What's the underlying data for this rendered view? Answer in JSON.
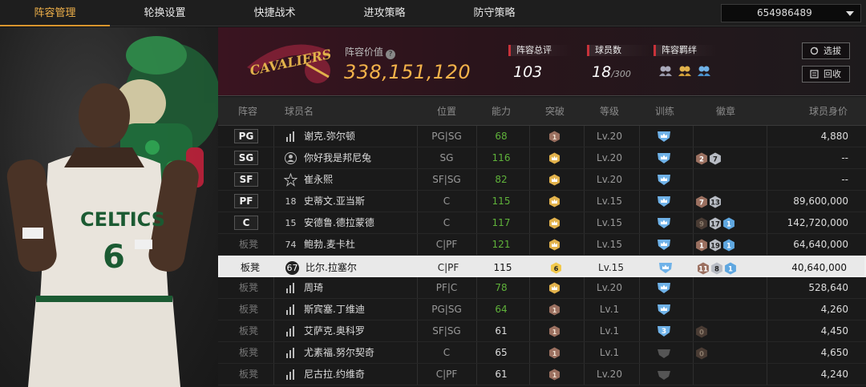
{
  "tabs": [
    "阵容管理",
    "轮换设置",
    "快捷战术",
    "进攻策略",
    "防守策略"
  ],
  "account": "654986489",
  "header": {
    "logo_text": "CAVALIERS",
    "value_label": "阵容价值",
    "value": "338,151,120",
    "stats": [
      {
        "label": "阵容总评",
        "value": "103",
        "suffix": ""
      },
      {
        "label": "球员数",
        "value": "18",
        "suffix": "/300"
      },
      {
        "label": "阵容羁绊",
        "value": "",
        "suffix": ""
      }
    ],
    "buttons": [
      "选拔",
      "回收"
    ]
  },
  "columns": [
    "阵容",
    "球员名",
    "位置",
    "能力",
    "突破",
    "等级",
    "训练",
    "徽章",
    "球员身价"
  ],
  "colors": {
    "accent": "#f0b14a",
    "green": "#5fb23a",
    "red": "#c8323a"
  },
  "rows": [
    {
      "slot": "PG",
      "starter": true,
      "icon": "stats",
      "name": "谢克.弥尔顿",
      "pos": "PG|SG",
      "ability": "68",
      "green": true,
      "break": "1",
      "break_type": "brown",
      "level": "Lv.20",
      "train": "crown",
      "badges": [],
      "value": "4,880"
    },
    {
      "slot": "SG",
      "starter": true,
      "icon": "person",
      "name": "你好我是邦尼兔",
      "pos": "SG",
      "ability": "116",
      "green": true,
      "break": "",
      "break_type": "crown",
      "level": "Lv.20",
      "train": "crown",
      "badges": [
        {
          "t": "brown",
          "n": "2"
        },
        {
          "t": "silver",
          "n": "7"
        }
      ],
      "value": "--"
    },
    {
      "slot": "SF",
      "starter": true,
      "icon": "star",
      "name": "崔永熙",
      "pos": "SF|SG",
      "ability": "82",
      "green": true,
      "break": "",
      "break_type": "crown",
      "level": "Lv.20",
      "train": "crown",
      "badges": [],
      "value": "--"
    },
    {
      "slot": "PF",
      "starter": true,
      "icon": "18",
      "name": "史蒂文.亚当斯",
      "pos": "C",
      "ability": "115",
      "green": true,
      "break": "",
      "break_type": "crown",
      "level": "Lv.15",
      "train": "crown",
      "badges": [
        {
          "t": "brown",
          "n": "7"
        },
        {
          "t": "silver",
          "n": "13"
        }
      ],
      "value": "89,600,000"
    },
    {
      "slot": "C",
      "starter": true,
      "icon": "15",
      "name": "安德鲁.德拉蒙德",
      "pos": "C",
      "ability": "117",
      "green": true,
      "break": "",
      "break_type": "crown",
      "level": "Lv.15",
      "train": "crown",
      "badges": [
        {
          "t": "dark",
          "n": "9"
        },
        {
          "t": "silver",
          "n": "17"
        },
        {
          "t": "blue",
          "n": "1"
        }
      ],
      "value": "142,720,000"
    },
    {
      "slot": "板凳",
      "starter": false,
      "icon": "74",
      "name": "鲍勃.麦卡杜",
      "pos": "C|PF",
      "ability": "121",
      "green": true,
      "break": "",
      "break_type": "crown",
      "level": "Lv.15",
      "train": "crown",
      "badges": [
        {
          "t": "brown",
          "n": "1"
        },
        {
          "t": "silver",
          "n": "19"
        },
        {
          "t": "blue",
          "n": "1"
        }
      ],
      "value": "64,640,000"
    },
    {
      "slot": "板凳",
      "starter": false,
      "selected": true,
      "icon": "67",
      "name": "比尔.拉塞尔",
      "pos": "C|PF",
      "ability": "115",
      "green": false,
      "break": "6",
      "break_type": "gold",
      "level": "Lv.15",
      "train": "crown",
      "badges": [
        {
          "t": "brown",
          "n": "11"
        },
        {
          "t": "silver",
          "n": "8"
        },
        {
          "t": "blue",
          "n": "1"
        }
      ],
      "value": "40,640,000"
    },
    {
      "slot": "板凳",
      "starter": false,
      "icon": "stats",
      "name": "周琦",
      "pos": "PF|C",
      "ability": "78",
      "green": true,
      "break": "",
      "break_type": "crown",
      "level": "Lv.20",
      "train": "crown",
      "badges": [],
      "value": "528,640"
    },
    {
      "slot": "板凳",
      "starter": false,
      "icon": "stats",
      "name": "斯宾塞.丁维迪",
      "pos": "PG|SG",
      "ability": "64",
      "green": true,
      "break": "1",
      "break_type": "brown",
      "level": "Lv.1",
      "train": "crown",
      "badges": [],
      "value": "4,260"
    },
    {
      "slot": "板凳",
      "starter": false,
      "icon": "stats",
      "name": "艾萨克.奥科罗",
      "pos": "SF|SG",
      "ability": "61",
      "green": false,
      "break": "1",
      "break_type": "brown",
      "level": "Lv.1",
      "train": "3",
      "badges": [
        {
          "t": "dark",
          "n": "0"
        }
      ],
      "value": "4,450"
    },
    {
      "slot": "板凳",
      "starter": false,
      "icon": "stats",
      "name": "尤素福.努尔契奇",
      "pos": "C",
      "ability": "65",
      "green": false,
      "break": "1",
      "break_type": "brown",
      "level": "Lv.1",
      "train": "grey",
      "badges": [
        {
          "t": "dark",
          "n": "0"
        }
      ],
      "value": "4,650"
    },
    {
      "slot": "板凳",
      "starter": false,
      "icon": "stats",
      "name": "尼古拉.约维奇",
      "pos": "C|PF",
      "ability": "61",
      "green": false,
      "break": "1",
      "break_type": "brown",
      "level": "Lv.20",
      "train": "grey",
      "badges": [],
      "value": "4,240"
    }
  ]
}
